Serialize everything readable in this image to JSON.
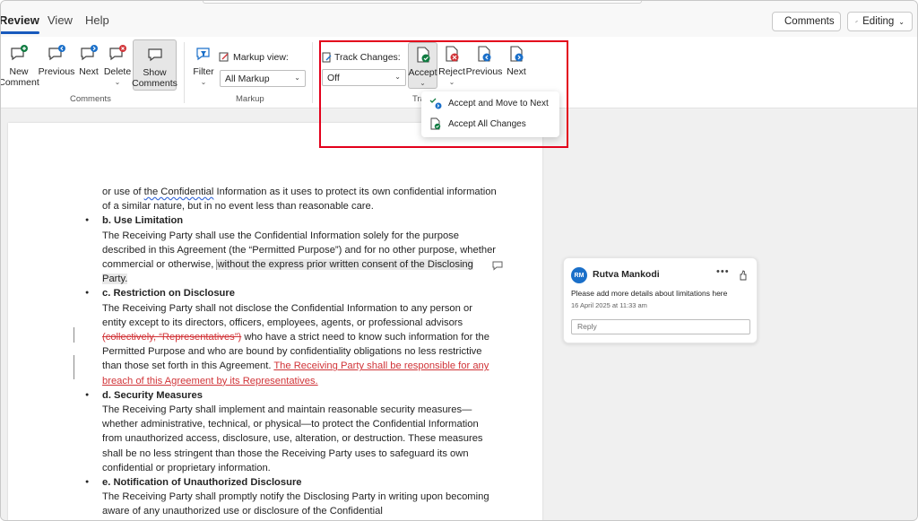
{
  "menu": {
    "tabs": [
      "Review",
      "View",
      "Help"
    ],
    "comments_button": "Comments",
    "editing_button": "Editing"
  },
  "ribbon": {
    "comments_group": {
      "label": "Comments",
      "new_comment": [
        "New",
        "Comment"
      ],
      "previous": "Previous",
      "next": "Next",
      "delete": "Delete",
      "show_comments": [
        "Show",
        "Comments"
      ]
    },
    "markup_group": {
      "label": "Markup",
      "filter": "Filter",
      "markup_view_label": "Markup view:",
      "markup_view_value": "All Markup"
    },
    "tracking_group": {
      "label_visible": "Tra",
      "track_changes_label": "Track Changes:",
      "track_changes_value": "Off",
      "accept": "Accept",
      "reject": "Reject",
      "previous": "Previous",
      "next": "Next"
    }
  },
  "accept_menu": {
    "items": [
      "Accept and Move to Next",
      "Accept All Changes"
    ]
  },
  "document": {
    "line1": "or use of ",
    "line1_link": "the Confidential",
    "line1_rest": " Information as it uses to protect its own confidential information of a similar nature, but in no event less than reasonable care.",
    "b_title": "b. Use Limitation",
    "b_body_1": " The Receiving Party shall use the Confidential Information solely for the purpose described in this Agreement (the “Permitted Purpose”) and for no other purpose, whether commercial or otherwise, ",
    "b_body_hl": "without the express prior written consent of the Disclosing Party.",
    "c_title": "c. Restriction on Disclosure",
    "c_body_1": " The Receiving Party shall not disclose the Confidential Information to any person or entity except to its directors, officers, employees, agents, or professional advisors ",
    "c_body_del": "(collectively, “Representatives”)",
    "c_body_2": " who have a strict need to know such information for the Permitted Purpose and who are bound by confidentiality obligations no less restrictive than those set forth in this Agreement. ",
    "c_body_ins": "The Receiving Party shall be responsible for any breach of this Agreement by its Representatives.",
    "d_title": "d. Security Measures",
    "d_body": " The Receiving Party shall implement and maintain reasonable security measures—whether administrative, technical, or physical—to protect the Confidential Information from unauthorized access, disclosure, use, alteration, or destruction. These measures shall be no less stringent than those the Receiving Party uses to safeguard its own confidential or proprietary information.",
    "e_title": "e. Notification of Unauthorized Disclosure",
    "e_body": " The Receiving Party shall promptly notify the Disclosing Party in writing upon becoming aware of any unauthorized use or disclosure of the Confidential"
  },
  "comment": {
    "initials": "RM",
    "author": "Rutva Mankodi",
    "text": "Please add more details about limitations here",
    "date": "16 April 2025 at 11:33 am",
    "reply_placeholder": "Reply"
  },
  "colors": {
    "accent": "#185abd",
    "tracked_change": "#d13438",
    "highlight_box": "#e3001b"
  }
}
